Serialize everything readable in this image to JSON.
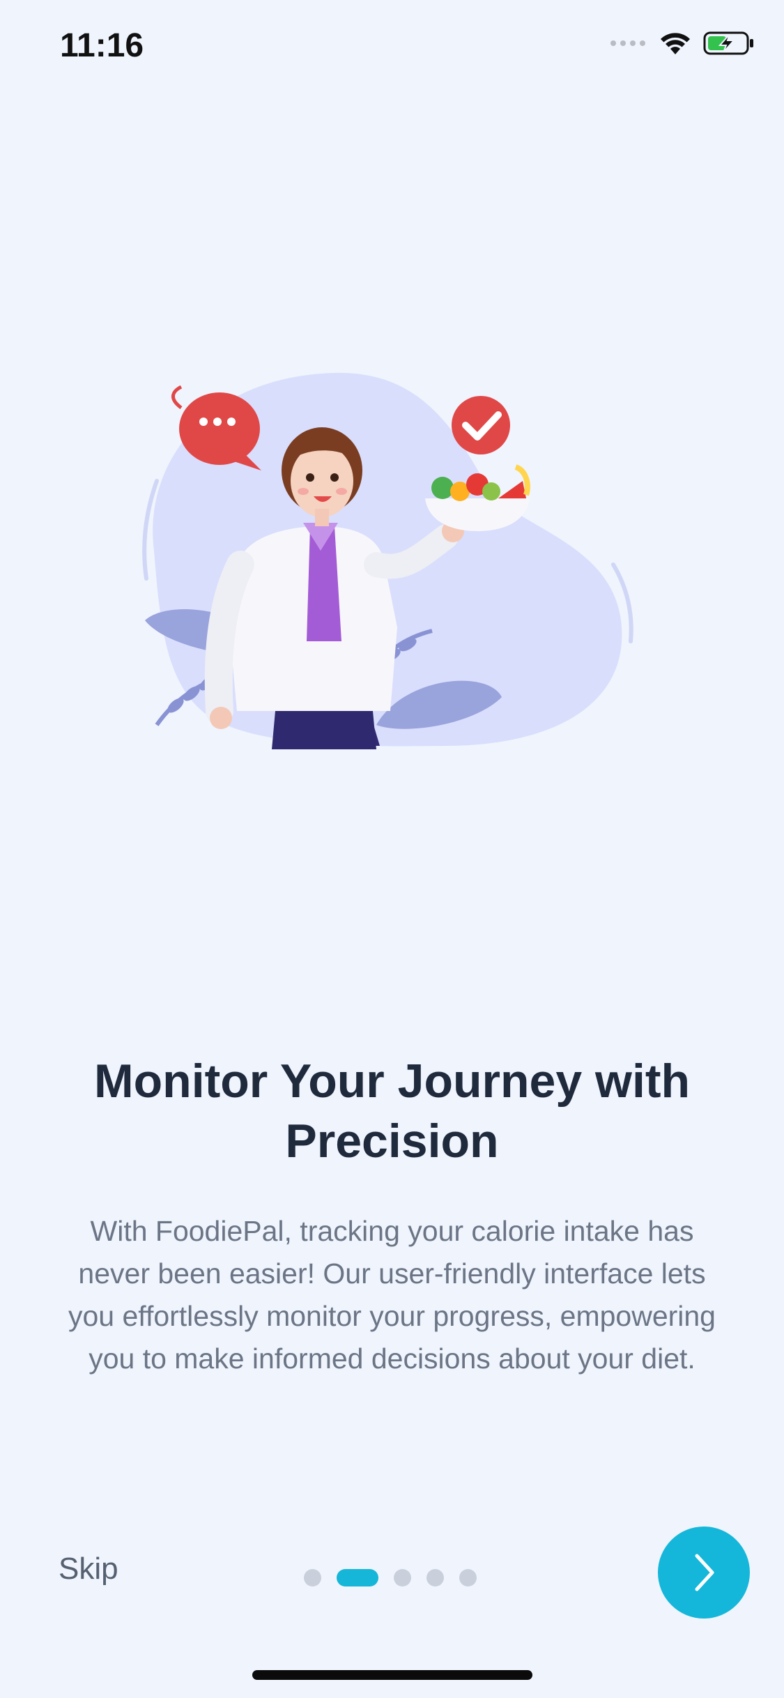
{
  "status_bar": {
    "time": "11:16",
    "icons": [
      "signal-dots-icon",
      "wifi-icon",
      "battery-charging-icon"
    ]
  },
  "illustration": {
    "name": "nutritionist-illustration",
    "icons": [
      "speech-bubble-icon",
      "checkmark-icon",
      "fruit-bowl-icon"
    ]
  },
  "onboarding": {
    "title": "Monitor Your Journey with Precision",
    "description": "With FoodiePal, tracking your calorie intake has never been easier! Our user-friendly interface lets you effortlessly monitor your progress, empowering you to make informed decisions about your diet.",
    "pages_total": 5,
    "current_page": 2
  },
  "nav": {
    "skip_label": "Skip",
    "next_icon": "chevron-right-icon"
  },
  "colors": {
    "background": "#eff4fd",
    "accent": "#14b7d9",
    "title": "#1f2a3c",
    "body_text": "#6b7585",
    "dot_inactive": "#c9d0db"
  }
}
